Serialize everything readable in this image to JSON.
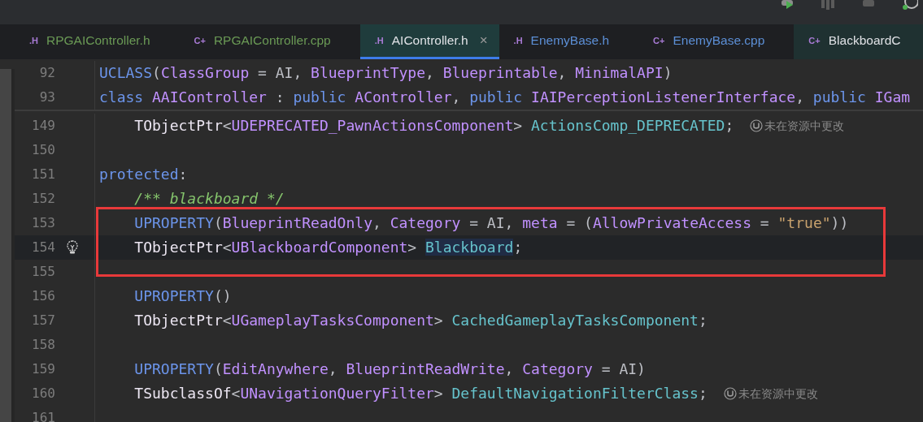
{
  "tabs": [
    {
      "badge": ".H",
      "label": "RPGAIController.h",
      "color": "#6a9955",
      "selected": false,
      "external": false
    },
    {
      "badge": "C+",
      "label": "RPGAIController.cpp",
      "color": "#6a9955",
      "selected": false,
      "external": false
    },
    {
      "badge": ".H",
      "label": "AIController.h",
      "color": "#dfe1e5",
      "selected": true,
      "external": true,
      "close": "×"
    },
    {
      "badge": ".H",
      "label": "EnemyBase.h",
      "color": "#5c8fd6",
      "selected": false,
      "external": false
    },
    {
      "badge": "C+",
      "label": "EnemyBase.cpp",
      "color": "#5c8fd6",
      "selected": false,
      "external": false
    },
    {
      "badge": "C+",
      "label": "BlackboardC",
      "color": "#dfe1e5",
      "selected": false,
      "external": true
    }
  ],
  "sticky_lines": [
    {
      "number": "92",
      "tokens": [
        {
          "text": "UCLASS",
          "kind": "kw"
        },
        {
          "text": "(",
          "kind": "plain"
        },
        {
          "text": "ClassGroup",
          "kind": "type"
        },
        {
          "text": " = AI, ",
          "kind": "plain"
        },
        {
          "text": "BlueprintType",
          "kind": "type"
        },
        {
          "text": ", ",
          "kind": "plain"
        },
        {
          "text": "Blueprintable",
          "kind": "type"
        },
        {
          "text": ", ",
          "kind": "plain"
        },
        {
          "text": "MinimalAPI",
          "kind": "type"
        },
        {
          "text": ")",
          "kind": "plain"
        }
      ]
    },
    {
      "number": "93",
      "tokens": [
        {
          "text": "class",
          "kind": "kw"
        },
        {
          "text": " AAIController",
          "kind": "type"
        },
        {
          "text": " : ",
          "kind": "plain"
        },
        {
          "text": "public",
          "kind": "kw"
        },
        {
          "text": " AController",
          "kind": "type"
        },
        {
          "text": ", ",
          "kind": "plain"
        },
        {
          "text": "public",
          "kind": "kw"
        },
        {
          "text": " IAIPerceptionListenerInterface",
          "kind": "type"
        },
        {
          "text": ", ",
          "kind": "plain"
        },
        {
          "text": "public",
          "kind": "kw"
        },
        {
          "text": " IGam",
          "kind": "type"
        }
      ]
    }
  ],
  "code_blocks": [
    {
      "kind": "plain",
      "lines": [
        {
          "number": "149",
          "kind": "normal",
          "tokens": [
            {
              "text": "    TObjectPtr",
              "kind": "tpl"
            },
            {
              "text": "<",
              "kind": "plain"
            },
            {
              "text": "UDEPRECATED_PawnActionsComponent",
              "kind": "type"
            },
            {
              "text": "> ",
              "kind": "plain"
            },
            {
              "text": "ActionsComp_DEPRECATED",
              "kind": "field"
            },
            {
              "text": ";",
              "kind": "plain"
            }
          ],
          "hint": "未在资源中更改"
        },
        {
          "number": "150",
          "kind": "normal"
        },
        {
          "number": "151",
          "kind": "normal",
          "tokens": [
            {
              "text": "protected",
              "kind": "kw"
            },
            {
              "text": ":",
              "kind": "plain"
            }
          ]
        },
        {
          "number": "152",
          "kind": "normal",
          "tokens": [
            {
              "text": "    /** blackboard */",
              "kind": "comment"
            }
          ]
        }
      ]
    },
    {
      "kind": "boxed",
      "lines": [
        {
          "number": "153",
          "kind": "normal",
          "tokens": [
            {
              "text": "    UPROPERTY",
              "kind": "kw"
            },
            {
              "text": "(",
              "kind": "plain"
            },
            {
              "text": "BlueprintReadOnly",
              "kind": "type"
            },
            {
              "text": ", ",
              "kind": "plain"
            },
            {
              "text": "Category",
              "kind": "type"
            },
            {
              "text": " = AI, ",
              "kind": "plain"
            },
            {
              "text": "meta",
              "kind": "type"
            },
            {
              "text": " = (",
              "kind": "plain"
            },
            {
              "text": "AllowPrivateAccess",
              "kind": "type"
            },
            {
              "text": " = ",
              "kind": "plain"
            },
            {
              "text": "\"true\"",
              "kind": "string"
            },
            {
              "text": "))",
              "kind": "plain"
            }
          ]
        },
        {
          "number": "154",
          "kind": "current",
          "tokens": [
            {
              "text": "    TObjectPtr",
              "kind": "tpl"
            },
            {
              "text": "<",
              "kind": "plain"
            },
            {
              "text": "UBlackboardComponent",
              "kind": "type"
            },
            {
              "text": "> ",
              "kind": "plain"
            },
            {
              "text": "Blackboard",
              "kind": "usage"
            },
            {
              "text": ";",
              "kind": "plain"
            }
          ]
        },
        {
          "number": "155",
          "kind": "normal"
        }
      ]
    },
    {
      "kind": "plain",
      "lines": [
        {
          "number": "156",
          "kind": "normal",
          "tokens": [
            {
              "text": "    UPROPERTY",
              "kind": "kw"
            },
            {
              "text": "()",
              "kind": "plain"
            }
          ]
        },
        {
          "number": "157",
          "kind": "normal",
          "tokens": [
            {
              "text": "    TObjectPtr",
              "kind": "tpl"
            },
            {
              "text": "<",
              "kind": "plain"
            },
            {
              "text": "UGameplayTasksComponent",
              "kind": "type"
            },
            {
              "text": "> ",
              "kind": "plain"
            },
            {
              "text": "CachedGameplayTasksComponent",
              "kind": "field"
            },
            {
              "text": ";",
              "kind": "plain"
            }
          ]
        },
        {
          "number": "158",
          "kind": "normal"
        },
        {
          "number": "159",
          "kind": "normal",
          "tokens": [
            {
              "text": "    UPROPERTY",
              "kind": "kw"
            },
            {
              "text": "(",
              "kind": "plain"
            },
            {
              "text": "EditAnywhere",
              "kind": "type"
            },
            {
              "text": ", ",
              "kind": "plain"
            },
            {
              "text": "BlueprintReadWrite",
              "kind": "type"
            },
            {
              "text": ", ",
              "kind": "plain"
            },
            {
              "text": "Category",
              "kind": "type"
            },
            {
              "text": " = AI)",
              "kind": "plain"
            }
          ]
        },
        {
          "number": "160",
          "kind": "normal",
          "tokens": [
            {
              "text": "    TSubclassOf",
              "kind": "tpl"
            },
            {
              "text": "<",
              "kind": "plain"
            },
            {
              "text": "UNavigationQueryFilter",
              "kind": "type"
            },
            {
              "text": "> ",
              "kind": "plain"
            },
            {
              "text": "DefaultNavigationFilterClass",
              "kind": "field"
            },
            {
              "text": ";",
              "kind": "plain"
            }
          ],
          "hint": "未在资源中更改"
        },
        {
          "number": "161",
          "kind": "normal"
        }
      ]
    }
  ]
}
